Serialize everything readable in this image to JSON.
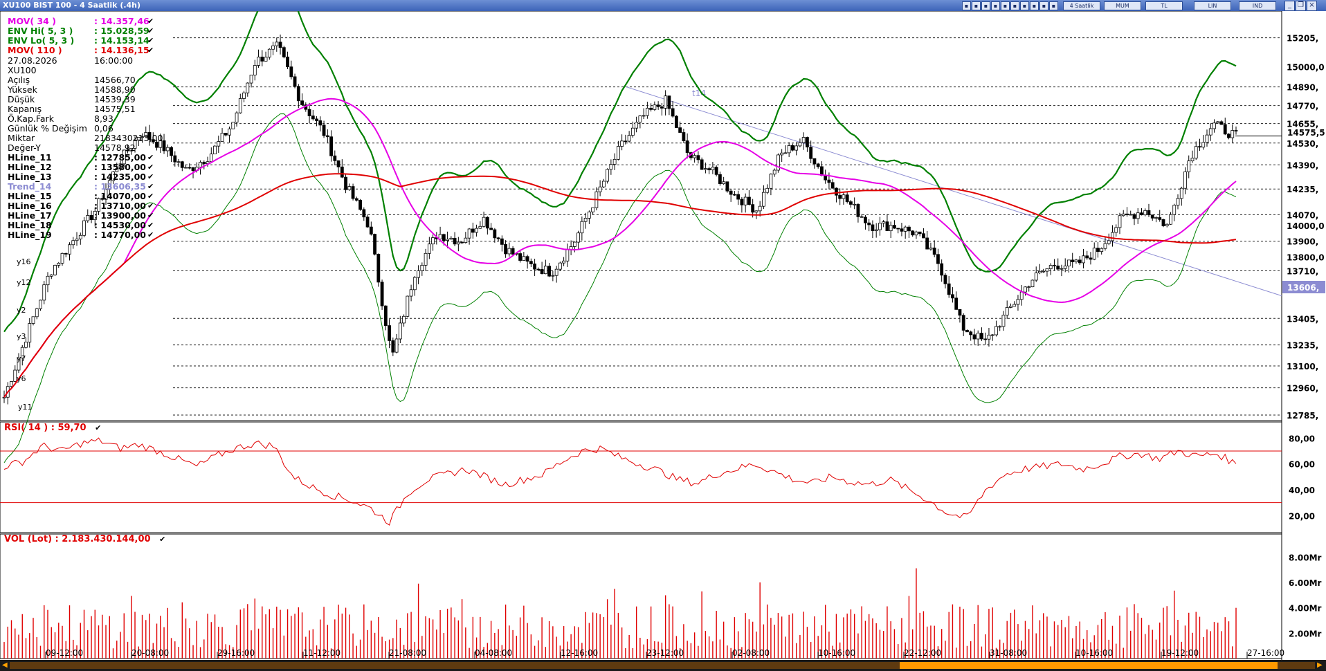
{
  "window": {
    "title": "XU100 BIST 100 - 4 Saatlik (.4h)",
    "toolbar": [
      "4 Saatlik",
      "MUM",
      "TL",
      "LIN",
      "IND"
    ]
  },
  "indicators": [
    {
      "label": "MOV( 34 )",
      "value": ": 14.357,46",
      "color": "#e600e6",
      "check": "✔"
    },
    {
      "label": "ENV Hi( 5, 3 )",
      "value": ": 15.028,59",
      "color": "#008000",
      "check": "✔"
    },
    {
      "label": "ENV Lo( 5, 3 )",
      "value": ": 14.153,14",
      "color": "#008000",
      "check": "✔"
    },
    {
      "label": "MOV( 110 )",
      "value": ": 14.136,15",
      "color": "#e00000",
      "check": "✔"
    }
  ],
  "quote": [
    {
      "label": "27.08.2026",
      "value": "16:00:00"
    },
    {
      "label": "XU100",
      "value": ""
    },
    {
      "label": "Açılış",
      "value": "14566,70"
    },
    {
      "label": "Yüksek",
      "value": "14588,90"
    },
    {
      "label": "Düşük",
      "value": "14539,39"
    },
    {
      "label": "Kapanış",
      "value": "14575,51"
    },
    {
      "label": "Ö.Kap.Fark",
      "value": "8,93"
    },
    {
      "label": "Günlük % Değişim",
      "value": "0,06"
    },
    {
      "label": "Miktar",
      "value": "2183430213,00"
    },
    {
      "label": "Değer-Y",
      "value": "14578,92"
    }
  ],
  "hlines": [
    {
      "label": "HLine_11",
      "value": ": 12785,00",
      "color": "#000000",
      "check": "✔"
    },
    {
      "label": "HLine_12",
      "value": ": 13580,00",
      "color": "#000000",
      "check": "✔"
    },
    {
      "label": "HLine_13",
      "value": ": 14235,00",
      "color": "#000000",
      "check": "✔"
    },
    {
      "label": "Trend_14",
      "value": ": 13606,35",
      "color": "#8c8cd2",
      "check": "✔"
    },
    {
      "label": "HLine_15",
      "value": ": 14070,00",
      "color": "#000000",
      "check": "✔"
    },
    {
      "label": "HLine_16",
      "value": ": 13710,00",
      "color": "#000000",
      "check": "✔"
    },
    {
      "label": "HLine_17",
      "value": ": 13900,00",
      "color": "#000000",
      "check": "✔"
    },
    {
      "label": "HLine_18",
      "value": ": 14530,00",
      "color": "#000000",
      "check": "✔"
    },
    {
      "label": "HLine_19",
      "value": ": 14770,00",
      "color": "#000000",
      "check": "✔"
    }
  ],
  "price_axis": {
    "hline_labels": [
      "15205,",
      "14890,",
      "14770,",
      "14655,",
      "14530,",
      "14390,",
      "14235,",
      "14070,",
      "13900,",
      "13710,",
      "13405,",
      "13235,",
      "13100,",
      "12960,",
      "12785,"
    ],
    "ticks": [
      "15000,0",
      "14000,0",
      "13800,0"
    ],
    "last_price": "14575,5",
    "trend_value": "13606,"
  },
  "annotations": {
    "trend_label": "t14",
    "wave_labels": [
      "y16",
      "y12",
      "y2",
      "y3",
      "y7",
      "y6",
      "y11"
    ]
  },
  "rsi": {
    "header": "RSI( 14 ) : 59,70",
    "ticks": [
      "80,00",
      "60,00",
      "40,00",
      "20,00"
    ]
  },
  "volume": {
    "header": "VOL (Lot) : 2.183.430.144,00",
    "ticks": [
      "8.00Mr",
      "6.00Mr",
      "4.00Mr",
      "2.00Mr"
    ]
  },
  "time_axis": [
    "09-12:00",
    "20-08:00",
    "29-16:00",
    "11-12:00",
    "21-08:00",
    "04-08:00",
    "12-16:00",
    "23-12:00",
    "02-08:00",
    "10-16:00",
    "22-12:00",
    "31-08:00",
    "10-16:00",
    "19-12:00",
    "27-16:00"
  ],
  "chart_data": {
    "type": "candlestick",
    "symbol": "XU100",
    "interval": "4h",
    "price_range": [
      12785,
      15400
    ],
    "horizontal_lines": [
      15205,
      14890,
      14770,
      14655,
      14530,
      14390,
      14235,
      14070,
      13900,
      13710,
      13405,
      13235,
      13100,
      12960,
      12785
    ],
    "close_path": [
      12900,
      13300,
      13700,
      13900,
      14100,
      14400,
      14600,
      14500,
      14350,
      14450,
      14650,
      15050,
      15150,
      14800,
      14600,
      14250,
      14000,
      13150,
      13700,
      13950,
      13900,
      14050,
      13850,
      13750,
      13700,
      13900,
      14200,
      14500,
      14700,
      14800,
      14450,
      14350,
      14200,
      14100,
      14450,
      14550,
      14300,
      14150,
      14000,
      14000,
      13950,
      13750,
      13350,
      13250,
      13450,
      13650,
      13750,
      13750,
      13850,
      14050,
      14100,
      14000,
      14450,
      14650,
      14575
    ],
    "series": [
      {
        "name": "MOV( 34 )",
        "color": "#e600e6",
        "last": 14357.46
      },
      {
        "name": "ENV Hi( 5, 3 )",
        "color": "#008000",
        "last": 15028.59
      },
      {
        "name": "ENV Lo( 5, 3 )",
        "color": "#008000",
        "last": 14153.14
      },
      {
        "name": "MOV( 110 )",
        "color": "#e00000",
        "last": 14136.15
      }
    ],
    "trendline": {
      "name": "Trend_14",
      "value": 13606.35
    },
    "rsi_range": [
      10,
      85
    ],
    "rsi_levels": [
      70,
      30
    ],
    "rsi_path": [
      58,
      62,
      74,
      70,
      76,
      78,
      72,
      75,
      70,
      64,
      58,
      66,
      72,
      76,
      74,
      50,
      42,
      36,
      32,
      26,
      15,
      38,
      48,
      52,
      56,
      50,
      44,
      48,
      52,
      62,
      70,
      72,
      65,
      60,
      55,
      48,
      45,
      52,
      56,
      60,
      54,
      48,
      45,
      50,
      46,
      44,
      48,
      40,
      32,
      22,
      18,
      40,
      52,
      56,
      58,
      60,
      56,
      60,
      66,
      68,
      64,
      70,
      66,
      68,
      60
    ],
    "volume_range": [
      0,
      9
    ],
    "volume_unit": "Mr"
  }
}
